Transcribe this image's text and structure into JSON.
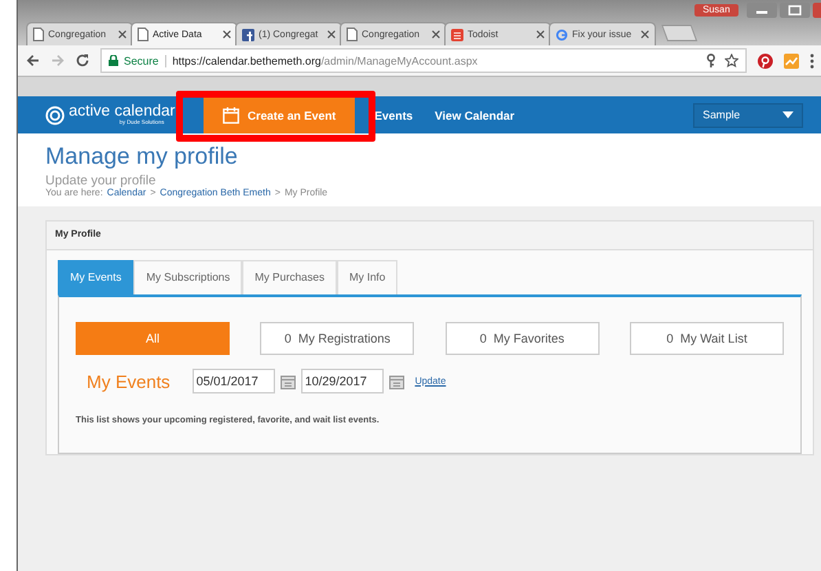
{
  "browser": {
    "user": "Susan",
    "tabs": [
      {
        "title": "Congregation",
        "kind": "page",
        "selected": false
      },
      {
        "title": "Active Data",
        "kind": "page",
        "selected": true
      },
      {
        "title": "(1) Congregat",
        "kind": "facebook",
        "selected": false
      },
      {
        "title": "Congregation",
        "kind": "page",
        "selected": false
      },
      {
        "title": "Todoist",
        "kind": "todoist",
        "selected": false
      },
      {
        "title": "Fix your issue",
        "kind": "google",
        "selected": false
      }
    ],
    "secure_label": "Secure",
    "url_host": "https://calendar.bethemeth.org",
    "url_path": "/admin/ManageMyAccount.aspx"
  },
  "nav": {
    "logo": "active calendar",
    "logo_sub": "by Dude Solutions",
    "items": [
      {
        "label": "Create an Event",
        "selected": true
      },
      {
        "label": "Events",
        "selected": false
      },
      {
        "label": "View Calendar",
        "selected": false
      }
    ],
    "account": "Sample"
  },
  "header": {
    "title": "Manage my profile",
    "subtitle": "Update your profile",
    "breadcrumb_prefix": "You are here:",
    "separator": ">",
    "breadcrumb": [
      "Calendar",
      "Congregation Beth Emeth",
      "My Profile"
    ]
  },
  "panel": {
    "title": "My Profile",
    "tabs": [
      {
        "label": "My Events",
        "selected": true
      },
      {
        "label": "My Subscriptions",
        "selected": false
      },
      {
        "label": "My Purchases",
        "selected": false
      },
      {
        "label": "My Info",
        "selected": false
      }
    ],
    "filters": [
      {
        "label": "All",
        "selected": true
      },
      {
        "count": "0",
        "label": "My Registrations",
        "selected": false
      },
      {
        "count": "0",
        "label": "My Favorites",
        "selected": false
      },
      {
        "count": "0",
        "label": "My Wait List",
        "selected": false
      }
    ],
    "section_title": "My Events",
    "start_date": "05/01/2017",
    "end_date": "10/29/2017",
    "update_link": "Update",
    "note": "This list shows your upcoming registered, favorite, and wait list events."
  },
  "annotation": {
    "kind": "highlight-box",
    "color": "#ff0000"
  }
}
